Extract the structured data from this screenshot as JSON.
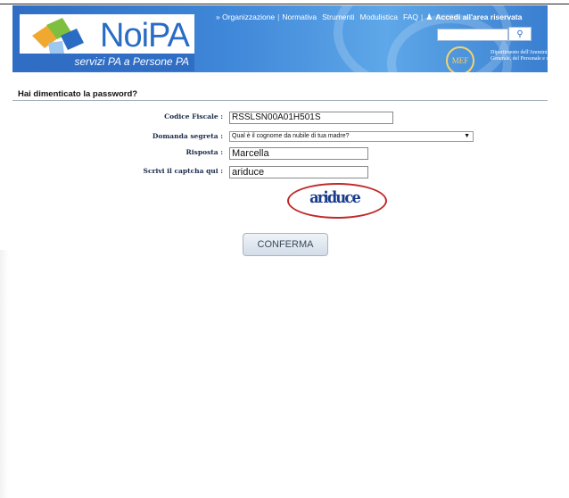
{
  "header": {
    "logo_title": "NoiPA",
    "logo_subtitle": "servizi PA a Persone PA",
    "nav": [
      "» Organizzazione",
      "Normativa",
      "Strumenti",
      "Modulistica",
      "FAQ"
    ],
    "reserved_area": "Accedi all'area riservata",
    "mef_logo": "MEF",
    "mef_text": "Dipartimento dell'Amministrazione Generale, del Personale e dei Servizi"
  },
  "page": {
    "title": "Hai dimenticato la password?"
  },
  "form": {
    "codice_fiscale": {
      "label": "Codice Fiscale :",
      "value": "RSSLSN00A01H501S"
    },
    "domanda_segreta": {
      "label": "Domanda segreta :",
      "value": "Qual è il cognome da nubile di tua madre?"
    },
    "risposta": {
      "label": "Risposta :",
      "value": "Marcella"
    },
    "captcha": {
      "label": "Scrivi il captcha qui :",
      "value": "ariduce",
      "image_text": "ariduce"
    },
    "confirm_label": "CONFERMA"
  },
  "colors": {
    "banner": "#3f87d8",
    "captcha_highlight": "#c0282a"
  }
}
